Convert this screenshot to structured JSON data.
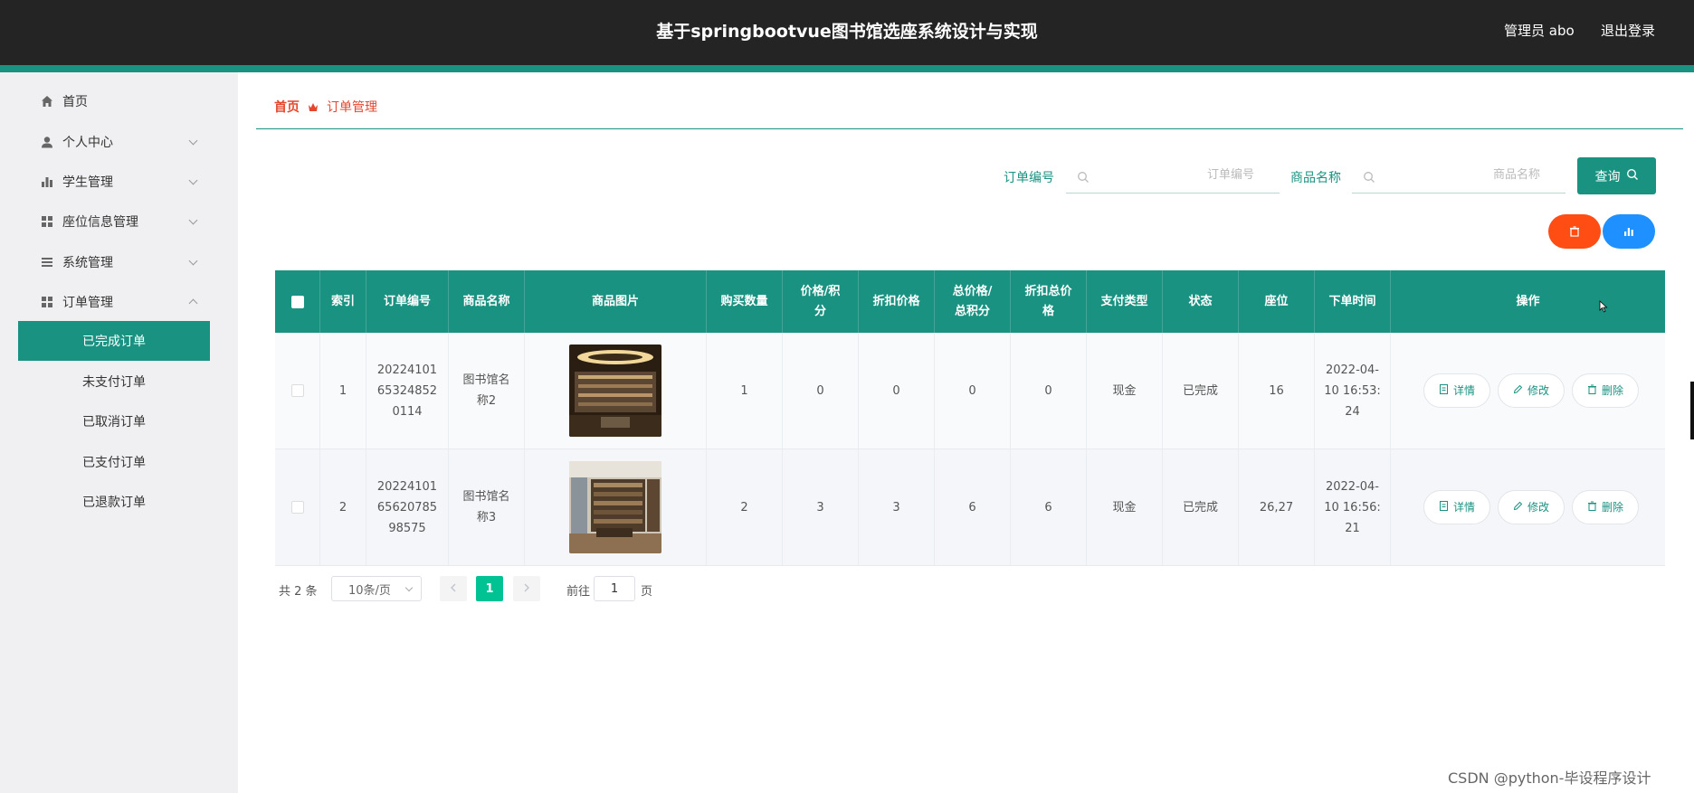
{
  "header": {
    "title": "基于springbootvue图书馆选座系统设计与实现",
    "admin": "管理员 abo",
    "logout": "退出登录"
  },
  "sidebar": {
    "items": [
      {
        "label": "首页",
        "icon": "home-icon"
      },
      {
        "label": "个人中心",
        "icon": "user-icon"
      },
      {
        "label": "学生管理",
        "icon": "bar-chart-icon"
      },
      {
        "label": "座位信息管理",
        "icon": "grid-icon"
      },
      {
        "label": "系统管理",
        "icon": "list-icon"
      },
      {
        "label": "订单管理",
        "icon": "grid-icon"
      }
    ],
    "subitems": [
      {
        "label": "已完成订单",
        "active": true
      },
      {
        "label": "未支付订单"
      },
      {
        "label": "已取消订单"
      },
      {
        "label": "已支付订单"
      },
      {
        "label": "已退款订单"
      }
    ]
  },
  "breadcrumb": {
    "home": "首页",
    "current": "订单管理"
  },
  "search": {
    "order_label": "订单编号",
    "order_placeholder": "订单编号",
    "product_label": "商品名称",
    "product_placeholder": "商品名称",
    "query_label": "查询"
  },
  "table": {
    "headers": [
      "索引",
      "订单编号",
      "商品名称",
      "商品图片",
      "购买数量",
      "价格/积分",
      "折扣价格",
      "总价格/总积分",
      "折扣总价格",
      "支付类型",
      "状态",
      "座位",
      "下单时间",
      "操作"
    ],
    "header_lines": {
      "price": [
        "价格/积",
        "分"
      ],
      "total": [
        "总价格/",
        "总积分"
      ],
      "disc_total": [
        "折扣总价",
        "格"
      ]
    },
    "rows": [
      {
        "index": "1",
        "order_no": [
          "20224101",
          "65324852",
          "0114"
        ],
        "product": [
          "图书馆名",
          "称2"
        ],
        "qty": "1",
        "price": "0",
        "disc": "0",
        "total": "0",
        "disc_total": "0",
        "pay": "现金",
        "status": "已完成",
        "seat": "16",
        "time": [
          "2022-04-",
          "10 16:53:",
          "24"
        ]
      },
      {
        "index": "2",
        "order_no": [
          "20224101",
          "65620785",
          "98575"
        ],
        "product": [
          "图书馆名",
          "称3"
        ],
        "qty": "2",
        "price": "3",
        "disc": "3",
        "total": "6",
        "disc_total": "6",
        "pay": "现金",
        "status": "已完成",
        "seat": "26,27",
        "time": [
          "2022-04-",
          "10 16:56:",
          "21"
        ]
      }
    ],
    "actions": {
      "detail": "详情",
      "edit": "修改",
      "delete": "删除"
    }
  },
  "pagination": {
    "total": "共 2 条",
    "page_size": "10条/页",
    "current": "1",
    "goto": "前往",
    "goto_value": "1",
    "unit": "页"
  },
  "watermark": "CSDN @python-毕设程序设计",
  "colors": {
    "primary": "#1a9282",
    "danger": "#ff4d14",
    "info": "#1e90ff",
    "page_active": "#00c292",
    "breadcrumb": "#e5472d"
  }
}
